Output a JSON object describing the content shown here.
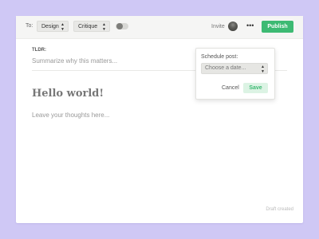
{
  "topbar": {
    "to_label": "To:",
    "category_select": "Design",
    "type_select": "Critique",
    "invite_label": "Invite",
    "more_icon": "more-horizontal-icon",
    "publish_label": "Publish"
  },
  "editor": {
    "tldr_label": "TLDR:",
    "summary_placeholder": "Summarize why this matters...",
    "title": "Hello world!",
    "body_placeholder": "Leave your thoughts here...",
    "status": "Draft created"
  },
  "schedule_popover": {
    "label": "Schedule post:",
    "date_placeholder": "Choose a date...",
    "cancel_label": "Cancel",
    "save_label": "Save"
  },
  "colors": {
    "background": "#cfc8f5",
    "accent": "#3dba73",
    "save_bg": "#dcf3e4"
  }
}
